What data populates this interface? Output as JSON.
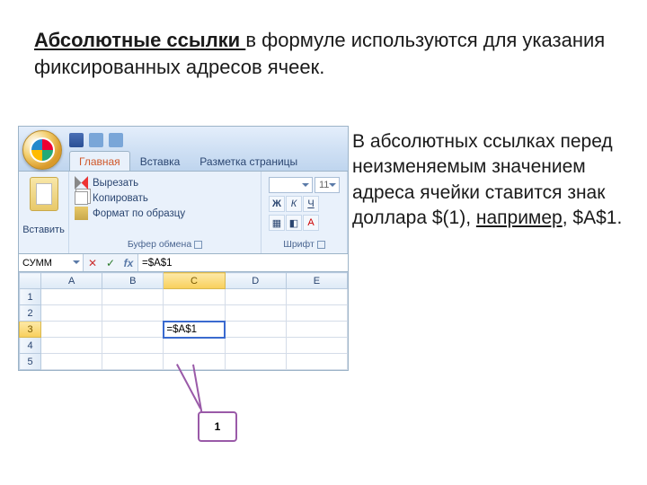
{
  "heading": {
    "underlined": "Абсолютные  ссылки ",
    "rest": "в формуле используются для указания фиксированных адресов ячеек."
  },
  "side": {
    "part1": "В абсолютных ссылках перед неизменяемым значением адреса ячейки ставится знак доллара $(1), ",
    "underlined": "например",
    "part2": ", $A$1."
  },
  "excel": {
    "tabs": {
      "home": "Главная",
      "insert": "Вставка",
      "layout": "Разметка страницы"
    },
    "paste_label": "Вставить",
    "clip": {
      "cut": "Вырезать",
      "copy": "Копировать",
      "format": "Формат по образцу",
      "group": "Буфер обмена"
    },
    "font": {
      "size": "11",
      "group": "Шрифт"
    },
    "namebox": "СУММ",
    "formula": "=$A$1",
    "cols": [
      "A",
      "B",
      "C",
      "D",
      "E"
    ],
    "rows": [
      "1",
      "2",
      "3",
      "4",
      "5"
    ],
    "active_cell_value": "=$A$1"
  },
  "callout": {
    "label": "1"
  }
}
